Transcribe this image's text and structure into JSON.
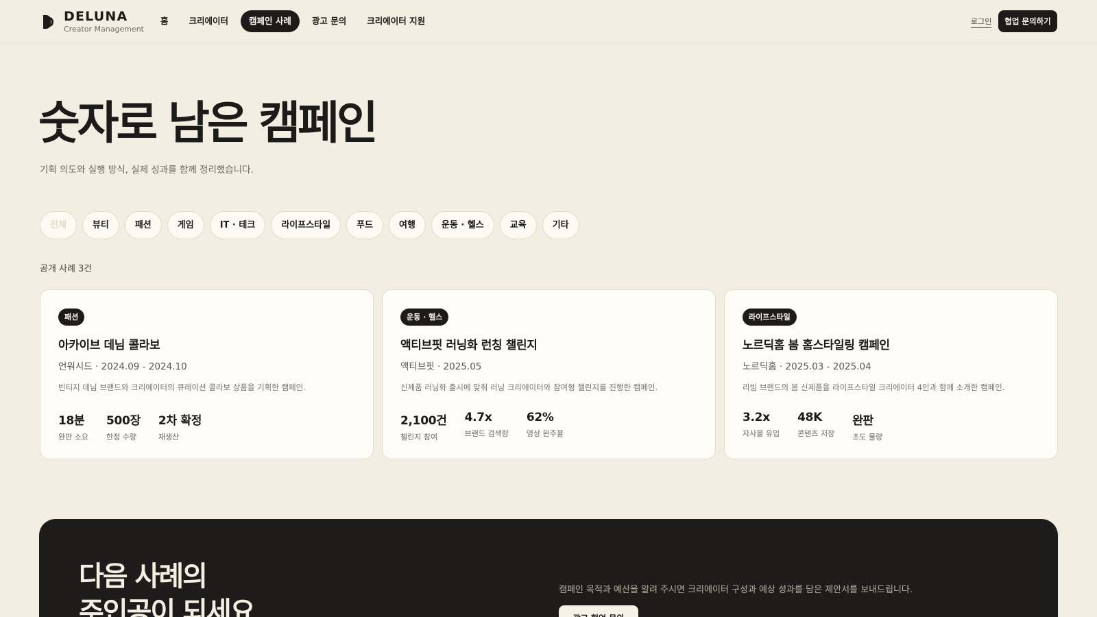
{
  "header": {
    "brand_name": "DELUNA",
    "brand_sub": "Creator Management",
    "nav": [
      {
        "label": "홈",
        "active": false
      },
      {
        "label": "크리에이터",
        "active": false
      },
      {
        "label": "캠페인 사례",
        "active": true
      },
      {
        "label": "광고 문의",
        "active": false
      },
      {
        "label": "크리에이터 지원",
        "active": false
      }
    ],
    "login_label": "로그인",
    "cta_label": "협업 문의하기"
  },
  "hero": {
    "title": "숫자로 남은 캠페인",
    "subtitle": "기획 의도와 실행 방식, 실제 성과를 함께 정리했습니다."
  },
  "filters": [
    {
      "label": "전체",
      "active": true
    },
    {
      "label": "뷰티",
      "active": false
    },
    {
      "label": "패션",
      "active": false
    },
    {
      "label": "게임",
      "active": false
    },
    {
      "label": "IT · 테크",
      "active": false
    },
    {
      "label": "라이프스타일",
      "active": false
    },
    {
      "label": "푸드",
      "active": false
    },
    {
      "label": "여행",
      "active": false
    },
    {
      "label": "운동 · 헬스",
      "active": false
    },
    {
      "label": "교육",
      "active": false
    },
    {
      "label": "기타",
      "active": false
    }
  ],
  "result_count": "공개 사례 3건",
  "cards": [
    {
      "badge": "패션",
      "title": "아카이브 데님 콜라보",
      "meta": "언워시드 · 2024.09 - 2024.10",
      "desc": "빈티지 데님 브랜드와 크리에이터의 큐레이션 콜라보 상품을 기획한 캠페인.",
      "stats": [
        {
          "value": "18분",
          "label": "완판 소요"
        },
        {
          "value": "500장",
          "label": "한정 수량"
        },
        {
          "value": "2차 확정",
          "label": "재생산"
        }
      ]
    },
    {
      "badge": "운동 · 헬스",
      "title": "액티브핏 러닝화 런칭 챌린지",
      "meta": "액티브핏 · 2025.05",
      "desc": "신제품 러닝화 출시에 맞춰 러닝 크리에이터와 참여형 챌린지를 진행한 캠페인.",
      "stats": [
        {
          "value": "2,100건",
          "label": "챌린지 참여"
        },
        {
          "value": "4.7x",
          "label": "브랜드 검색량"
        },
        {
          "value": "62%",
          "label": "영상 완주율"
        }
      ]
    },
    {
      "badge": "라이프스타일",
      "title": "노르딕홈 봄 홈스타일링 캠페인",
      "meta": "노르딕홈 · 2025.03 - 2025.04",
      "desc": "리빙 브랜드의 봄 신제품을 라이프스타일 크리에이터 4인과 함께 소개한 캠페인.",
      "stats": [
        {
          "value": "3.2x",
          "label": "자사몰 유입"
        },
        {
          "value": "48K",
          "label": "콘텐츠 저장"
        },
        {
          "value": "완판",
          "label": "초도 물량"
        }
      ]
    }
  ],
  "cta_section": {
    "heading_line1": "다음 사례의",
    "heading_line2": "주인공이 되세요",
    "desc": "캠페인 목적과 예산을 알려 주시면 크리에이터 구성과 예상 성과를 담은 제안서를 보내드립니다.",
    "button_label": "광고 협업 문의"
  },
  "colors": {
    "background": "#f3eee2",
    "ink": "#1c1b19",
    "card": "#fdfcf7",
    "cta_dark": "#1d1c1a"
  }
}
